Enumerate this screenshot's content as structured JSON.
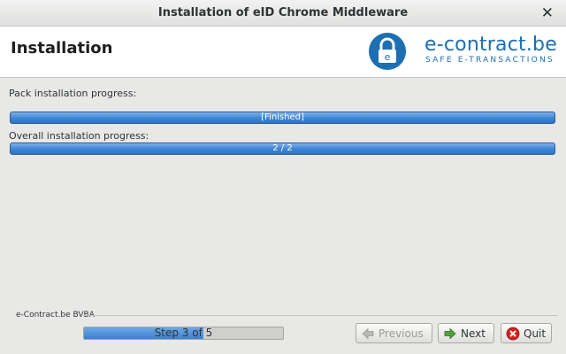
{
  "window": {
    "title": "Installation of  eID Chrome Middleware"
  },
  "header": {
    "heading": "Installation",
    "brand": "e-contract.be",
    "tagline": "SAFE E-TRANSACTIONS"
  },
  "progress": {
    "pack_label": "Pack installation progress:",
    "pack_text": "[Finished]",
    "pack_fraction": 1.0,
    "overall_label": "Overall installation progress:",
    "overall_text": "2 / 2",
    "overall_fraction": 1.0
  },
  "footer": {
    "company": "e-Contract.be BVBA",
    "step_text": "Step 3 of 5",
    "step_fraction": 0.6
  },
  "buttons": {
    "previous": "Previous",
    "next": "Next",
    "quit": "Quit"
  },
  "colors": {
    "accent": "#1c6fb3",
    "progress": "#3c85d7",
    "quit_icon": "#d3201f",
    "next_icon": "#4ea43b"
  }
}
